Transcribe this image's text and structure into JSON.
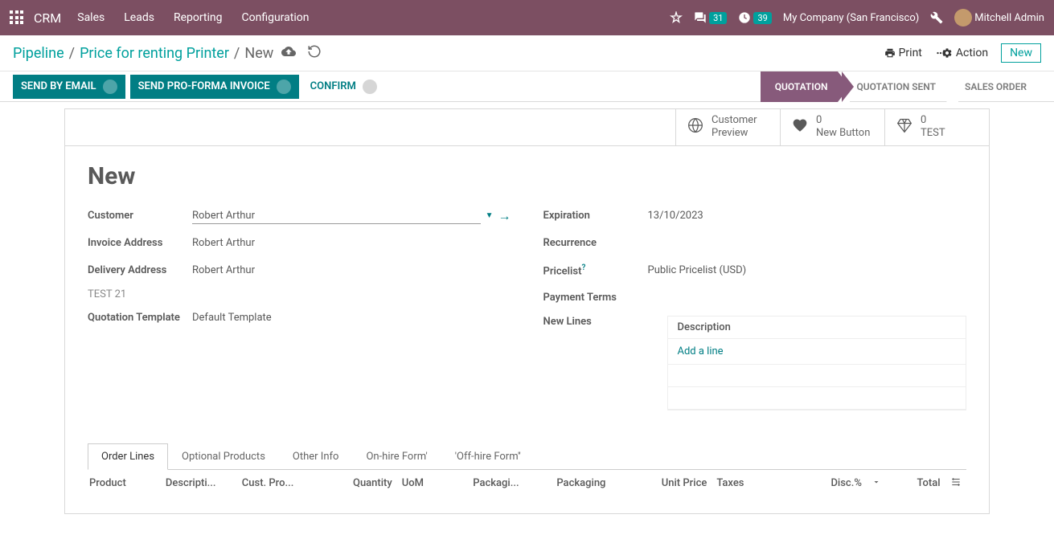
{
  "topnav": {
    "brand": "CRM",
    "menu": [
      "Sales",
      "Leads",
      "Reporting",
      "Configuration"
    ],
    "messages_count": "31",
    "activities_count": "39",
    "company": "My Company (San Francisco)",
    "user": "Mitchell Admin"
  },
  "breadcrumb": {
    "items": [
      "Pipeline",
      "Price for renting Printer"
    ],
    "current": "New",
    "print": "Print",
    "action": "Action",
    "new": "New"
  },
  "actionbar": {
    "send_email": "SEND BY EMAIL",
    "send_proforma": "SEND PRO-FORMA INVOICE",
    "confirm": "CONFIRM",
    "statuses": [
      "QUOTATION",
      "QUOTATION SENT",
      "SALES ORDER"
    ]
  },
  "stats": [
    {
      "icon": "globe",
      "line1": "Customer",
      "line2": "Preview"
    },
    {
      "icon": "heart",
      "line1": "0",
      "line2": "New Button"
    },
    {
      "icon": "diamond",
      "line1": "0",
      "line2": "TEST"
    }
  ],
  "form": {
    "title": "New",
    "left": {
      "customer_label": "Customer",
      "customer_value": "Robert Arthur",
      "invoice_label": "Invoice Address",
      "invoice_value": "Robert Arthur",
      "delivery_label": "Delivery Address",
      "delivery_value": "Robert Arthur",
      "test_badge": "TEST 21",
      "template_label": "Quotation Template",
      "template_value": "Default Template"
    },
    "right": {
      "expiration_label": "Expiration",
      "expiration_value": "13/10/2023",
      "recurrence_label": "Recurrence",
      "pricelist_label": "Pricelist",
      "pricelist_value": "Public Pricelist (USD)",
      "payment_label": "Payment Terms",
      "newlines_label": "New Lines",
      "newlines_header": "Description",
      "newlines_add": "Add a line"
    }
  },
  "tabs": [
    "Order Lines",
    "Optional Products",
    "Other Info",
    "On-hire Form'",
    "'Off-hire Form''"
  ],
  "orderlines_cols": {
    "product": "Product",
    "desc": "Descripti...",
    "custp": "Cust. Pro...",
    "qty": "Quantity",
    "uom": "UoM",
    "pkg1": "Packagi...",
    "pkg2": "Packaging",
    "price": "Unit Price",
    "taxes": "Taxes",
    "disc": "Disc.%",
    "total": "Total"
  }
}
